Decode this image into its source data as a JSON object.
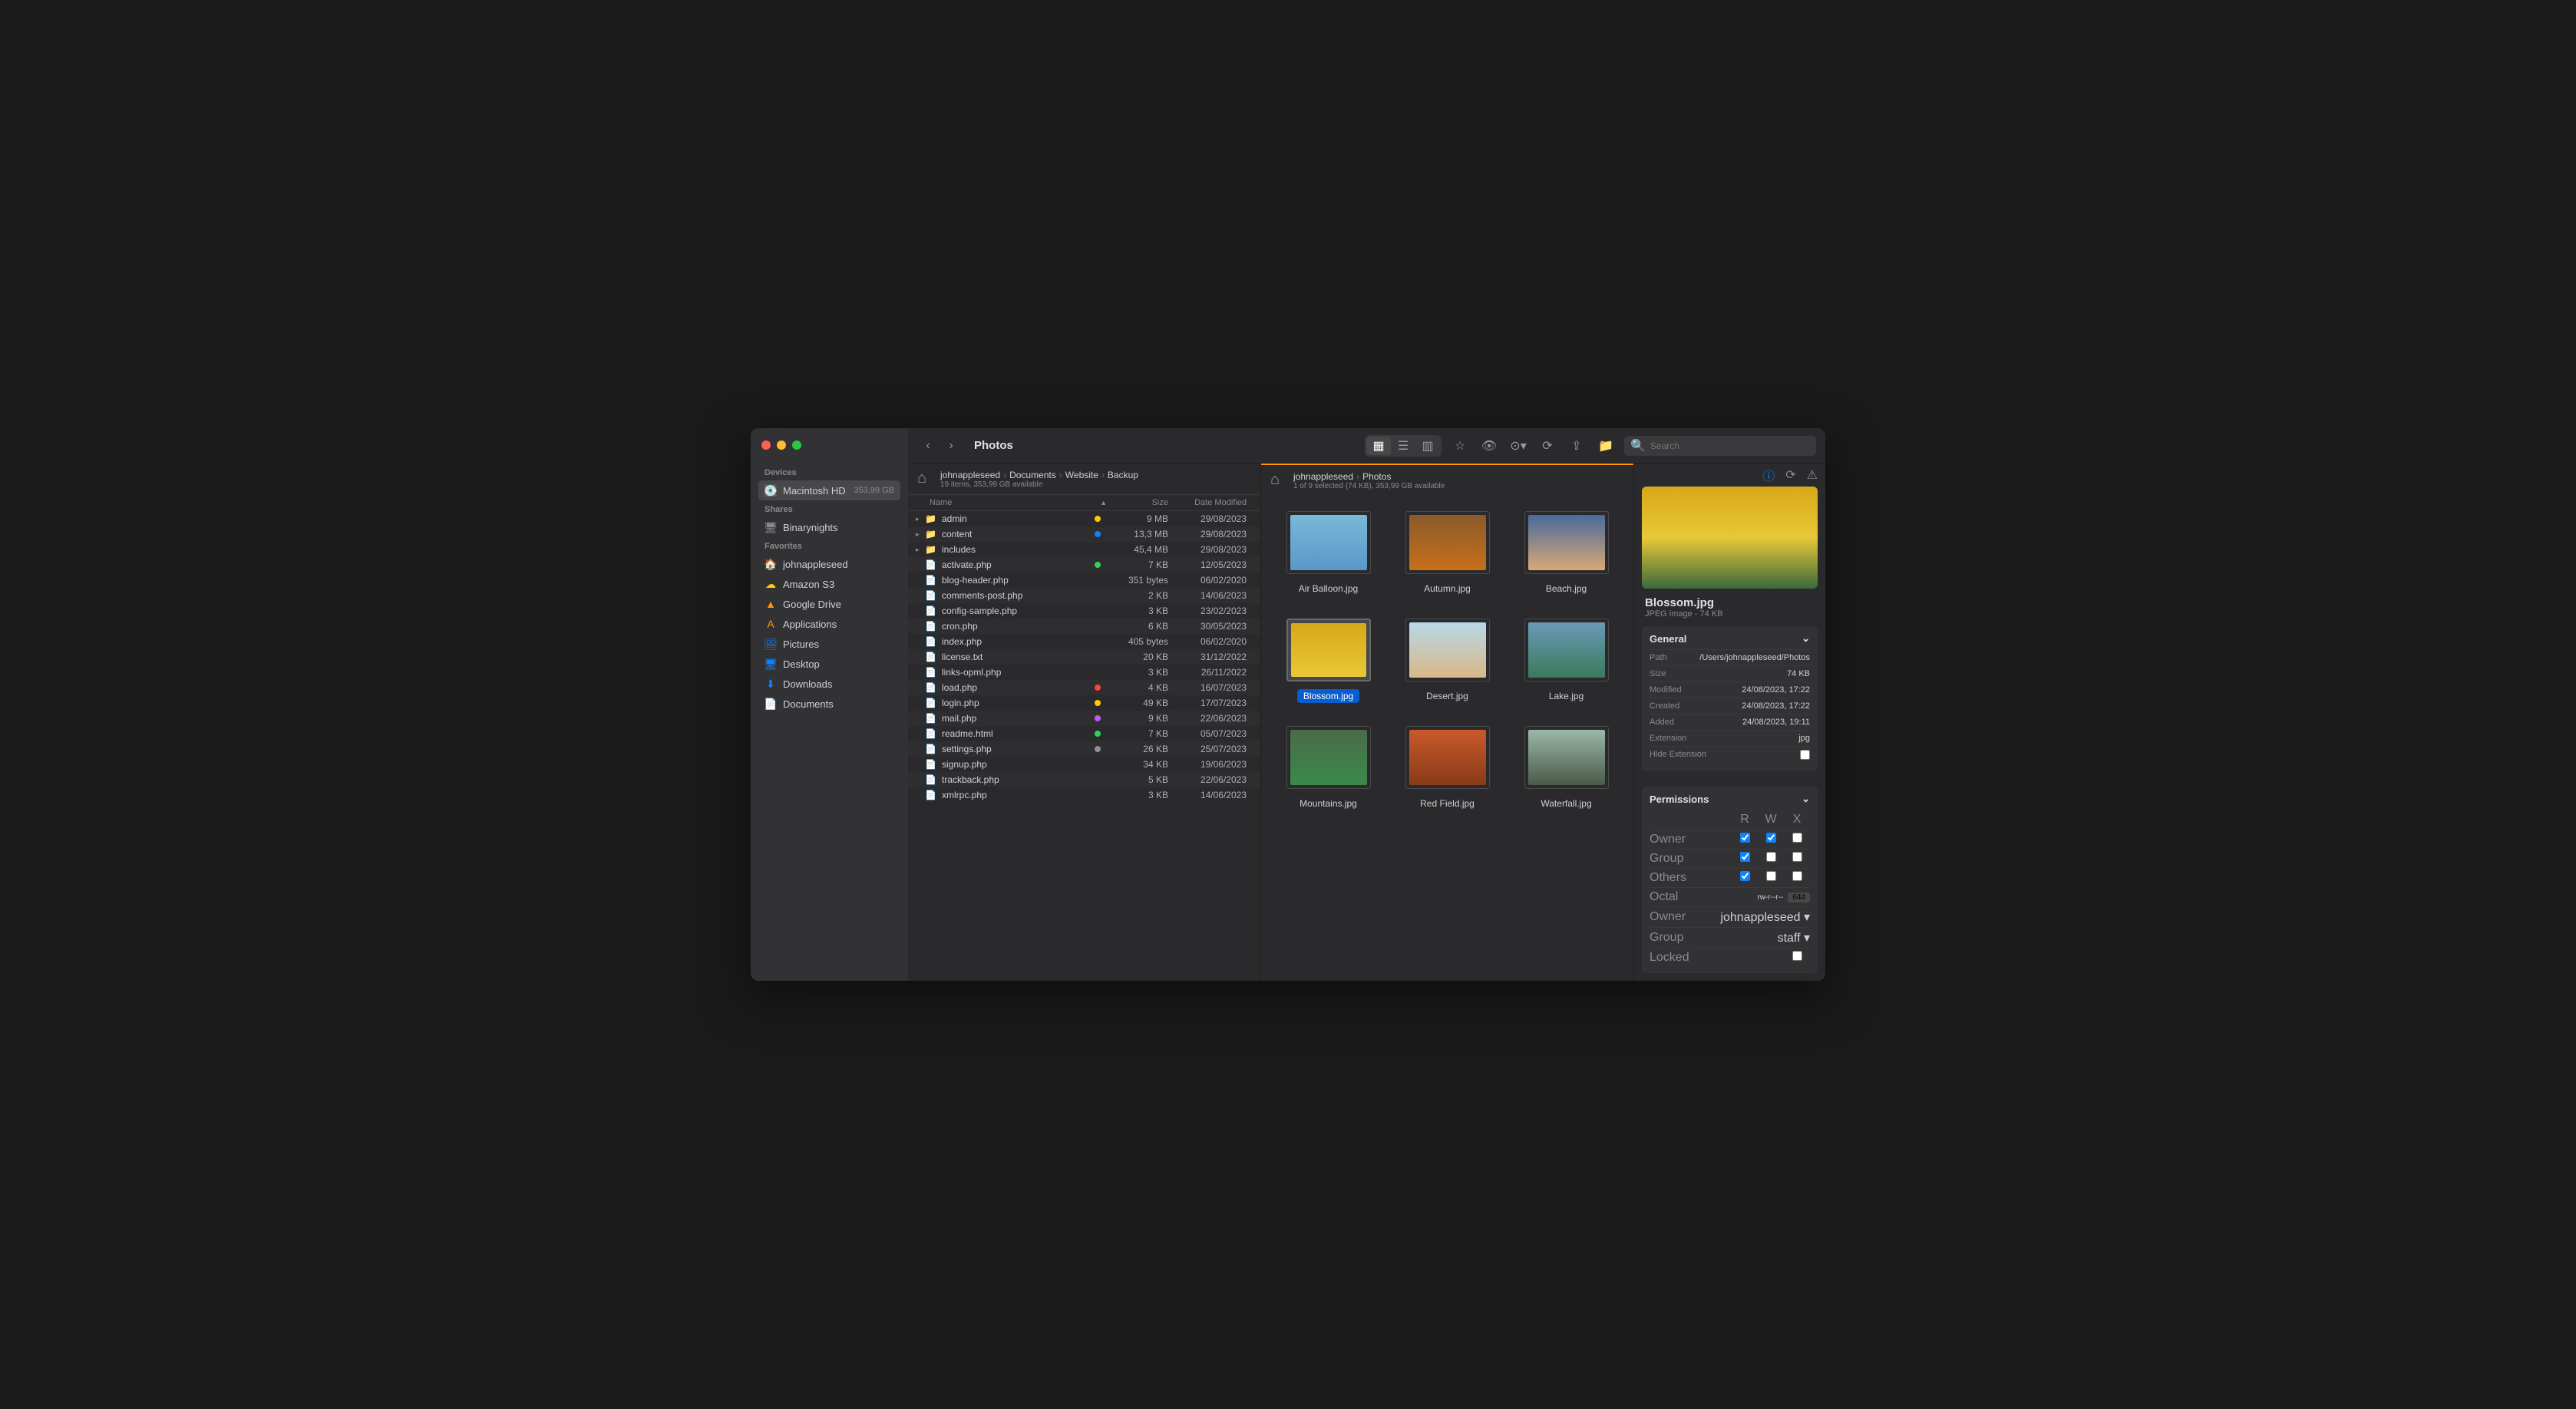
{
  "window_title": "Photos",
  "sidebar": {
    "devices_label": "Devices",
    "devices": [
      {
        "name": "Macintosh HD",
        "meta": "353,99 GB",
        "icon": "💽"
      }
    ],
    "shares_label": "Shares",
    "shares": [
      {
        "name": "Binarynights",
        "icon": "🖥"
      }
    ],
    "favorites_label": "Favorites",
    "favorites": [
      {
        "name": "johnappleseed",
        "icon": "🏠",
        "color": "#ff9500"
      },
      {
        "name": "Amazon S3",
        "icon": "☁",
        "color": "#ffcc00"
      },
      {
        "name": "Google Drive",
        "icon": "▲",
        "color": "#ff9500"
      },
      {
        "name": "Applications",
        "icon": "A",
        "color": "#ff9500"
      },
      {
        "name": "Pictures",
        "icon": "🖼",
        "color": "#0a84ff"
      },
      {
        "name": "Desktop",
        "icon": "🖥",
        "color": "#0a84ff"
      },
      {
        "name": "Downloads",
        "icon": "⬇",
        "color": "#0a84ff"
      },
      {
        "name": "Documents",
        "icon": "📄",
        "color": "#0a84ff"
      }
    ]
  },
  "search_placeholder": "Search",
  "left_pane": {
    "crumbs": [
      "johnappleseed",
      "Documents",
      "Website",
      "Backup"
    ],
    "status": "19 items, 353,99 GB available",
    "columns": {
      "name": "Name",
      "size": "Size",
      "date": "Date Modified"
    },
    "files": [
      {
        "d": true,
        "name": "admin",
        "tag": "#ffcc00",
        "size": "9 MB",
        "date": "29/08/2023"
      },
      {
        "d": true,
        "name": "content",
        "tag": "#0a84ff",
        "size": "13,3 MB",
        "date": "29/08/2023"
      },
      {
        "d": true,
        "name": "includes",
        "tag": "",
        "size": "45,4 MB",
        "date": "29/08/2023"
      },
      {
        "d": false,
        "name": "activate.php",
        "tag": "#30d158",
        "size": "7 KB",
        "date": "12/05/2023"
      },
      {
        "d": false,
        "name": "blog-header.php",
        "tag": "",
        "size": "351 bytes",
        "date": "06/02/2020"
      },
      {
        "d": false,
        "name": "comments-post.php",
        "tag": "",
        "size": "2 KB",
        "date": "14/06/2023"
      },
      {
        "d": false,
        "name": "config-sample.php",
        "tag": "",
        "size": "3 KB",
        "date": "23/02/2023"
      },
      {
        "d": false,
        "name": "cron.php",
        "tag": "",
        "size": "6 KB",
        "date": "30/05/2023"
      },
      {
        "d": false,
        "name": "index.php",
        "tag": "",
        "size": "405 bytes",
        "date": "06/02/2020"
      },
      {
        "d": false,
        "name": "license.txt",
        "tag": "",
        "size": "20 KB",
        "date": "31/12/2022"
      },
      {
        "d": false,
        "name": "links-opml.php",
        "tag": "",
        "size": "3 KB",
        "date": "26/11/2022"
      },
      {
        "d": false,
        "name": "load.php",
        "tag": "#ff453a",
        "size": "4 KB",
        "date": "16/07/2023"
      },
      {
        "d": false,
        "name": "login.php",
        "tag": "#ffcc00",
        "size": "49 KB",
        "date": "17/07/2023"
      },
      {
        "d": false,
        "name": "mail.php",
        "tag": "#bf5af2",
        "size": "9 KB",
        "date": "22/06/2023"
      },
      {
        "d": false,
        "name": "readme.html",
        "tag": "#30d158",
        "size": "7 KB",
        "date": "05/07/2023"
      },
      {
        "d": false,
        "name": "settings.php",
        "tag": "#8e8e93",
        "size": "26 KB",
        "date": "25/07/2023"
      },
      {
        "d": false,
        "name": "signup.php",
        "tag": "",
        "size": "34 KB",
        "date": "19/06/2023"
      },
      {
        "d": false,
        "name": "trackback.php",
        "tag": "",
        "size": "5 KB",
        "date": "22/06/2023"
      },
      {
        "d": false,
        "name": "xmlrpc.php",
        "tag": "",
        "size": "3 KB",
        "date": "14/06/2023"
      }
    ]
  },
  "center_pane": {
    "crumbs": [
      "johnappleseed",
      "Photos"
    ],
    "status": "1 of 9 selected (74 KB), 353,99 GB available",
    "items": [
      {
        "name": "Air Balloon.jpg",
        "bg": "linear-gradient(#7ab8d8,#5a98c8)"
      },
      {
        "name": "Autumn.jpg",
        "bg": "linear-gradient(#8a5a2a,#c8701a)"
      },
      {
        "name": "Beach.jpg",
        "bg": "linear-gradient(#4a6a9a,#d8a878)"
      },
      {
        "name": "Blossom.jpg",
        "bg": "linear-gradient(#d8a818,#e8c838)",
        "selected": true
      },
      {
        "name": "Desert.jpg",
        "bg": "linear-gradient(#b8d8e8,#d8b888)"
      },
      {
        "name": "Lake.jpg",
        "bg": "linear-gradient(#6a9ab8,#3a7a5a)"
      },
      {
        "name": "Mountains.jpg",
        "bg": "linear-gradient(#4a6a4a,#3a8a4a)"
      },
      {
        "name": "Red Field.jpg",
        "bg": "linear-gradient(#c85a2a,#8a3a1a)"
      },
      {
        "name": "Waterfall.jpg",
        "bg": "linear-gradient(#9ab8a8,#4a5a4a)"
      }
    ]
  },
  "inspector": {
    "filename": "Blossom.jpg",
    "filetype": "JPEG image - 74 KB",
    "general_label": "General",
    "general": [
      {
        "k": "Path",
        "v": "/Users/johnappleseed/Photos"
      },
      {
        "k": "Size",
        "v": "74 KB"
      },
      {
        "k": "Modified",
        "v": "24/08/2023, 17:22"
      },
      {
        "k": "Created",
        "v": "24/08/2023, 17:22"
      },
      {
        "k": "Added",
        "v": "24/08/2023, 19:11"
      },
      {
        "k": "Extension",
        "v": "jpg"
      },
      {
        "k": "Hide Extension",
        "v": ""
      }
    ],
    "permissions_label": "Permissions",
    "perm_cols": {
      "r": "R",
      "w": "W",
      "x": "X"
    },
    "perm_rows": [
      {
        "label": "Owner",
        "r": true,
        "w": true,
        "x": false
      },
      {
        "label": "Group",
        "r": true,
        "w": false,
        "x": false
      },
      {
        "label": "Others",
        "r": true,
        "w": false,
        "x": false
      }
    ],
    "octal_label": "Octal",
    "octal_text": "rw-r--r--",
    "octal_value": "644",
    "owner_label": "Owner",
    "owner_value": "johnappleseed",
    "group_label": "Group",
    "group_value": "staff",
    "locked_label": "Locked"
  }
}
